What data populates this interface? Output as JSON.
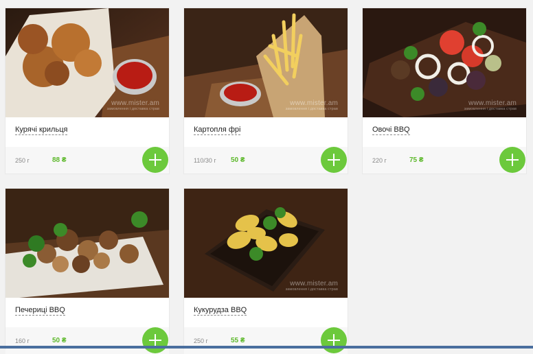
{
  "brand": {
    "accent_green": "#6cc93c",
    "price_green": "#5cb82a",
    "watermark_site": "www.mister.am",
    "watermark_tag": "замовлення і доставка страв"
  },
  "products": [
    {
      "name": "Курячі крильця",
      "weight": "250 г",
      "price": "88 ₴",
      "button_icon": "plus-icon"
    },
    {
      "name": "Картопля фрі",
      "weight": "110/30 г",
      "price": "50 ₴",
      "button_icon": "plus-icon"
    },
    {
      "name": "Овочі BBQ",
      "weight": "220 г",
      "price": "75 ₴",
      "button_icon": "plus-icon"
    },
    {
      "name": "Печериці BBQ",
      "weight": "160 г",
      "price": "50 ₴",
      "button_icon": "plus-icon"
    },
    {
      "name": "Кукурудза BBQ",
      "weight": "250 г",
      "price": "55 ₴",
      "button_icon": "plus-icon"
    }
  ]
}
